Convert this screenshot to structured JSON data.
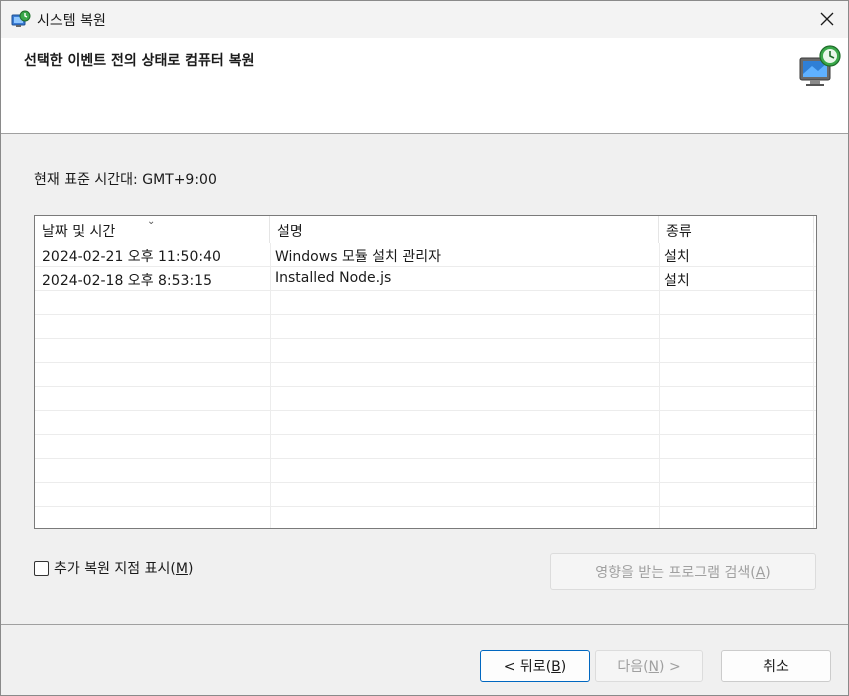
{
  "window": {
    "title": "시스템 복원"
  },
  "header": {
    "title": "선택한 이벤트 전의 상태로 컴퓨터 복원"
  },
  "timezone": {
    "label": "현재 표준 시간대: GMT+9:00"
  },
  "table": {
    "columns": [
      "날짜 및 시간",
      "설명",
      "종류"
    ],
    "rows": [
      {
        "date": "2024-02-21 오후 11:50:40",
        "description": "Windows 모듈 설치 관리자",
        "type": "설치"
      },
      {
        "date": "2024-02-18 오후 8:53:15",
        "description": "Installed Node.js",
        "type": "설치"
      }
    ]
  },
  "options": {
    "show_more_label": "추가 복원 지점 표시(",
    "show_more_key": "M",
    "show_more_suffix": ")",
    "show_more_checked": false,
    "scan_label": "영향을 받는 프로그램 검색(",
    "scan_key": "A",
    "scan_suffix": ")"
  },
  "buttons": {
    "back_label": "< 뒤로(",
    "back_key": "B",
    "back_suffix": ")",
    "next_label": "다음(",
    "next_key": "N",
    "next_suffix": ") >",
    "cancel_label": "취소"
  },
  "colors": {
    "accent": "#0067c0",
    "disabled_text": "#a0a0a0"
  }
}
